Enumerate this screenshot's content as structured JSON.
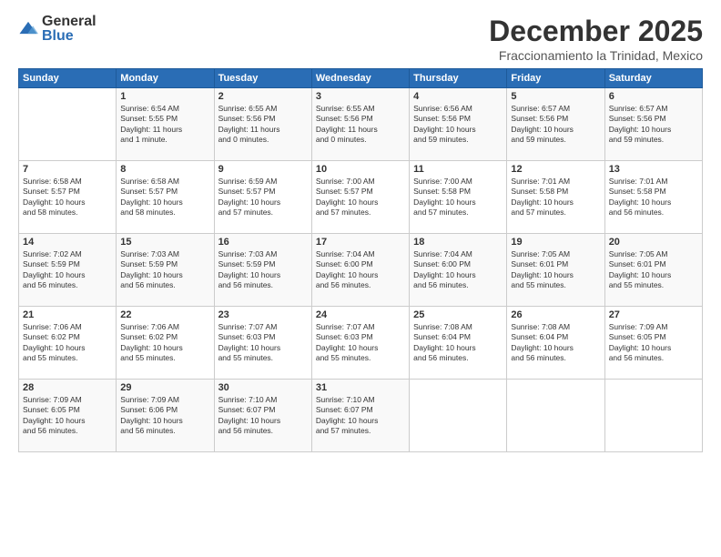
{
  "logo": {
    "general": "General",
    "blue": "Blue"
  },
  "header": {
    "month": "December 2025",
    "location": "Fraccionamiento la Trinidad, Mexico"
  },
  "days_of_week": [
    "Sunday",
    "Monday",
    "Tuesday",
    "Wednesday",
    "Thursday",
    "Friday",
    "Saturday"
  ],
  "weeks": [
    [
      {
        "day": "",
        "content": ""
      },
      {
        "day": "1",
        "content": "Sunrise: 6:54 AM\nSunset: 5:55 PM\nDaylight: 11 hours\nand 1 minute."
      },
      {
        "day": "2",
        "content": "Sunrise: 6:55 AM\nSunset: 5:56 PM\nDaylight: 11 hours\nand 0 minutes."
      },
      {
        "day": "3",
        "content": "Sunrise: 6:55 AM\nSunset: 5:56 PM\nDaylight: 11 hours\nand 0 minutes."
      },
      {
        "day": "4",
        "content": "Sunrise: 6:56 AM\nSunset: 5:56 PM\nDaylight: 10 hours\nand 59 minutes."
      },
      {
        "day": "5",
        "content": "Sunrise: 6:57 AM\nSunset: 5:56 PM\nDaylight: 10 hours\nand 59 minutes."
      },
      {
        "day": "6",
        "content": "Sunrise: 6:57 AM\nSunset: 5:56 PM\nDaylight: 10 hours\nand 59 minutes."
      }
    ],
    [
      {
        "day": "7",
        "content": "Sunrise: 6:58 AM\nSunset: 5:57 PM\nDaylight: 10 hours\nand 58 minutes."
      },
      {
        "day": "8",
        "content": "Sunrise: 6:58 AM\nSunset: 5:57 PM\nDaylight: 10 hours\nand 58 minutes."
      },
      {
        "day": "9",
        "content": "Sunrise: 6:59 AM\nSunset: 5:57 PM\nDaylight: 10 hours\nand 57 minutes."
      },
      {
        "day": "10",
        "content": "Sunrise: 7:00 AM\nSunset: 5:57 PM\nDaylight: 10 hours\nand 57 minutes."
      },
      {
        "day": "11",
        "content": "Sunrise: 7:00 AM\nSunset: 5:58 PM\nDaylight: 10 hours\nand 57 minutes."
      },
      {
        "day": "12",
        "content": "Sunrise: 7:01 AM\nSunset: 5:58 PM\nDaylight: 10 hours\nand 57 minutes."
      },
      {
        "day": "13",
        "content": "Sunrise: 7:01 AM\nSunset: 5:58 PM\nDaylight: 10 hours\nand 56 minutes."
      }
    ],
    [
      {
        "day": "14",
        "content": "Sunrise: 7:02 AM\nSunset: 5:59 PM\nDaylight: 10 hours\nand 56 minutes."
      },
      {
        "day": "15",
        "content": "Sunrise: 7:03 AM\nSunset: 5:59 PM\nDaylight: 10 hours\nand 56 minutes."
      },
      {
        "day": "16",
        "content": "Sunrise: 7:03 AM\nSunset: 5:59 PM\nDaylight: 10 hours\nand 56 minutes."
      },
      {
        "day": "17",
        "content": "Sunrise: 7:04 AM\nSunset: 6:00 PM\nDaylight: 10 hours\nand 56 minutes."
      },
      {
        "day": "18",
        "content": "Sunrise: 7:04 AM\nSunset: 6:00 PM\nDaylight: 10 hours\nand 56 minutes."
      },
      {
        "day": "19",
        "content": "Sunrise: 7:05 AM\nSunset: 6:01 PM\nDaylight: 10 hours\nand 55 minutes."
      },
      {
        "day": "20",
        "content": "Sunrise: 7:05 AM\nSunset: 6:01 PM\nDaylight: 10 hours\nand 55 minutes."
      }
    ],
    [
      {
        "day": "21",
        "content": "Sunrise: 7:06 AM\nSunset: 6:02 PM\nDaylight: 10 hours\nand 55 minutes."
      },
      {
        "day": "22",
        "content": "Sunrise: 7:06 AM\nSunset: 6:02 PM\nDaylight: 10 hours\nand 55 minutes."
      },
      {
        "day": "23",
        "content": "Sunrise: 7:07 AM\nSunset: 6:03 PM\nDaylight: 10 hours\nand 55 minutes."
      },
      {
        "day": "24",
        "content": "Sunrise: 7:07 AM\nSunset: 6:03 PM\nDaylight: 10 hours\nand 55 minutes."
      },
      {
        "day": "25",
        "content": "Sunrise: 7:08 AM\nSunset: 6:04 PM\nDaylight: 10 hours\nand 56 minutes."
      },
      {
        "day": "26",
        "content": "Sunrise: 7:08 AM\nSunset: 6:04 PM\nDaylight: 10 hours\nand 56 minutes."
      },
      {
        "day": "27",
        "content": "Sunrise: 7:09 AM\nSunset: 6:05 PM\nDaylight: 10 hours\nand 56 minutes."
      }
    ],
    [
      {
        "day": "28",
        "content": "Sunrise: 7:09 AM\nSunset: 6:05 PM\nDaylight: 10 hours\nand 56 minutes."
      },
      {
        "day": "29",
        "content": "Sunrise: 7:09 AM\nSunset: 6:06 PM\nDaylight: 10 hours\nand 56 minutes."
      },
      {
        "day": "30",
        "content": "Sunrise: 7:10 AM\nSunset: 6:07 PM\nDaylight: 10 hours\nand 56 minutes."
      },
      {
        "day": "31",
        "content": "Sunrise: 7:10 AM\nSunset: 6:07 PM\nDaylight: 10 hours\nand 57 minutes."
      },
      {
        "day": "",
        "content": ""
      },
      {
        "day": "",
        "content": ""
      },
      {
        "day": "",
        "content": ""
      }
    ]
  ]
}
